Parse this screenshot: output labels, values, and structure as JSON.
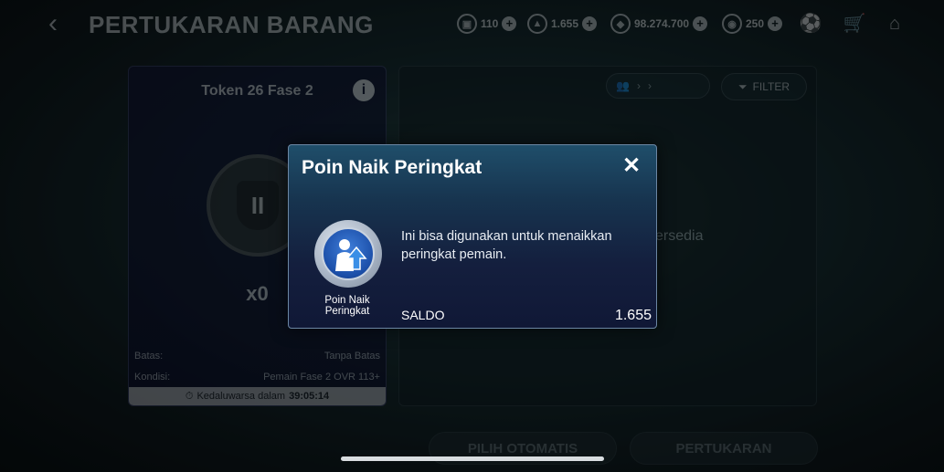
{
  "header": {
    "title": "PERTUKARAN BARANG",
    "currencies": [
      {
        "icon": "ticket-icon",
        "value": "110"
      },
      {
        "icon": "rank-up-point-icon",
        "value": "1.655"
      },
      {
        "icon": "coin-icon",
        "value": "98.274.700"
      },
      {
        "icon": "gem-icon",
        "value": "250"
      }
    ]
  },
  "left_card": {
    "title": "Token 26 Fase 2",
    "emblem": "II",
    "count": "x0",
    "limit_label": "Batas:",
    "limit_value": "Tanpa Batas",
    "condition_label": "Kondisi:",
    "condition_value": "Pemain Fase 2 OVR 113+",
    "expire_label": "Kedaluwarsa dalam",
    "expire_value": "39:05:14"
  },
  "right_panel": {
    "filter_label": "FILTER",
    "empty_text": "ersedia"
  },
  "bottom": {
    "auto_select_label": "PILIH OTOMATIS",
    "exchange_label": "PERTUKARAN"
  },
  "modal": {
    "title": "Poin Naik Peringkat",
    "close_symbol": "✕",
    "item_label": "Poin Naik Peringkat",
    "description": "Ini bisa digunakan untuk menaikkan peringkat pemain.",
    "saldo_label": "SALDO",
    "saldo_value": "1.655"
  },
  "colors": {
    "modal_border": "#6b86a3",
    "modal_top": "#1f4e6a",
    "modal_bottom": "#101836",
    "card_bg": "#0d1030"
  }
}
